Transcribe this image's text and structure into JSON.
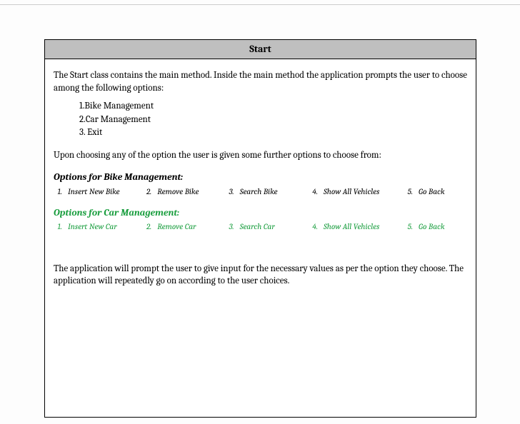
{
  "title": "Start",
  "intro": "The Start class contains the main method. Inside the main method the application prompts the user to choose among the following options:",
  "main_menu": {
    "item1": "1.Bike Management",
    "item2": "2.Car Management",
    "item3": "3. Exit"
  },
  "further": "Upon choosing any of the option the user is given some further options to choose from:",
  "bike": {
    "label": "Options for Bike Management:",
    "o1n": "1.",
    "o1": "Insert New Bike",
    "o2n": "2.",
    "o2": "Remove  Bike",
    "o3n": "3.",
    "o3": "Search Bike",
    "o4n": "4.",
    "o4": "Show All Vehicles",
    "o5n": "5.",
    "o5": "Go Back"
  },
  "car": {
    "label": "Options for Car  Management:",
    "o1n": "1.",
    "o1": "Insert New Car",
    "o2n": "2.",
    "o2": "Remove Car",
    "o3n": "3.",
    "o3": "Search Car",
    "o4n": "4.",
    "o4": "Show All Vehicles",
    "o5n": "5.",
    "o5": "Go Back"
  },
  "closing": "The application will prompt the user to give input for the necessary values as per the option they choose. The application will repeatedly go on according to the user choices."
}
